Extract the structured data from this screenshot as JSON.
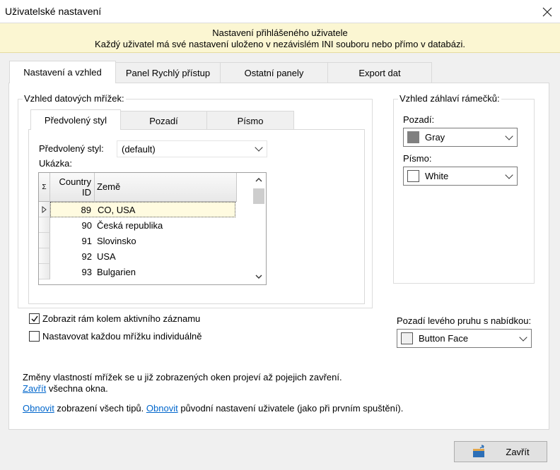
{
  "window": {
    "title": "Uživatelské nastavení",
    "close_icon": "close-icon"
  },
  "banner": {
    "line1": "Nastavení přihlášeného uživatele",
    "line2": "Každý uživatel má své nastavení uloženo v nezávislém INI souboru nebo přímo v databázi."
  },
  "tabs": [
    {
      "label": "Nastavení a vzhled",
      "active": true
    },
    {
      "label": "Panel Rychlý přístup",
      "active": false
    },
    {
      "label": "Ostatní panely",
      "active": false
    },
    {
      "label": "Export dat",
      "active": false
    }
  ],
  "grid_section": {
    "label": "Vzhled datových mřížek:",
    "inner_tabs": [
      {
        "label": "Předvolený styl",
        "active": true
      },
      {
        "label": "Pozadí",
        "active": false
      },
      {
        "label": "Písmo",
        "active": false
      }
    ],
    "style_label": "Předvolený styl:",
    "style_value": "(default)",
    "preview_label": "Ukázka:",
    "preview": {
      "sigma": "Σ",
      "columns": [
        "Country ID",
        "Země"
      ],
      "col1_line1": "Country",
      "col1_line2": "ID",
      "rows": [
        {
          "id": "89",
          "name": "CO, USA",
          "current": true
        },
        {
          "id": "90",
          "name": "Česká republika",
          "current": false
        },
        {
          "id": "91",
          "name": "Slovinsko",
          "current": false
        },
        {
          "id": "92",
          "name": "USA",
          "current": false
        },
        {
          "id": "93",
          "name": "Bulgarien",
          "current": false
        }
      ]
    }
  },
  "header_section": {
    "label": "Vzhled záhlaví rámečků:",
    "bg_label": "Pozadí:",
    "bg_value": "Gray",
    "bg_color": "#808080",
    "font_label": "Písmo:",
    "font_value": "White",
    "font_color": "#ffffff"
  },
  "checkboxes": [
    {
      "label": "Zobrazit rám kolem aktivního záznamu",
      "checked": true
    },
    {
      "label": "Nastavovat každou mřížku individuálně",
      "checked": false
    }
  ],
  "left_strip": {
    "label": "Pozadí levého pruhu s nabídkou:",
    "value": "Button Face",
    "color": "#f0f0f0"
  },
  "notes": {
    "line1": "Změny vlastností mřížek se u již zobrazených oken projeví až pojejich zavření.",
    "line2_link": "Zavřít",
    "line2_text": " všechna okna.",
    "line3_link1": "Obnovit",
    "line3_text1": " zobrazení všech tipů. ",
    "line3_link2": "Obnovit",
    "line3_text2": " původní nastavení uživatele (jako při prvním spuštění)."
  },
  "footer": {
    "close_label": "Zavřít",
    "close_icon": "exit-door-icon"
  }
}
